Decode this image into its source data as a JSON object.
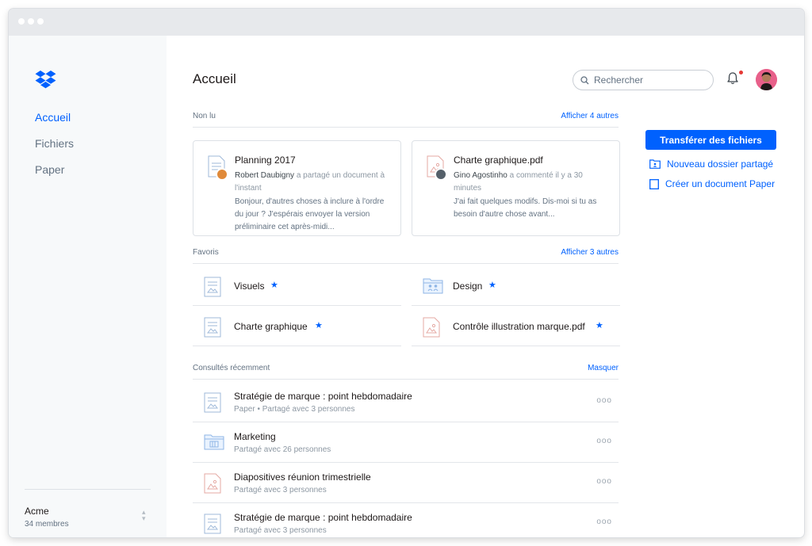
{
  "colors": {
    "accent": "#0061fe",
    "text": "#1e1919",
    "muted": "#637282",
    "notification": "#e53935"
  },
  "sidebar": {
    "logo_icon": "dropbox-logo-icon",
    "items": [
      {
        "label": "Accueil",
        "active": true
      },
      {
        "label": "Fichiers",
        "active": false
      },
      {
        "label": "Paper",
        "active": false
      }
    ],
    "team": {
      "name": "Acme",
      "members": "34 membres",
      "switch_icon": "chevron-updown-icon"
    }
  },
  "header": {
    "title": "Accueil",
    "search": {
      "placeholder": "Rechercher",
      "icon": "search-icon"
    },
    "bell_icon": "bell-icon",
    "has_notification": true,
    "avatar_icon": "user-avatar"
  },
  "unread": {
    "label": "Non lu",
    "action": "Afficher 4 autres",
    "cards": [
      {
        "title": "Planning 2017",
        "icon": "paper-doc-icon",
        "who": "Robert Daubigny",
        "action": " a partagé un document à l'instant",
        "excerpt": "Bonjour, d'autres choses à inclure à l'ordre du jour ? J'espérais envoyer la version préliminaire cet après-midi..."
      },
      {
        "title": "Charte graphique.pdf",
        "icon": "pdf-file-icon",
        "who": "Gino Agostinho",
        "action": " a commenté il y a 30 minutes",
        "excerpt": "J'ai fait quelques modifs. Dis-moi si tu as besoin d'autre chose avant..."
      }
    ]
  },
  "favorites": {
    "label": "Favoris",
    "action": "Afficher 3 autres",
    "items": [
      {
        "name": "Visuels",
        "icon": "paper-doc-icon",
        "starred": true
      },
      {
        "name": "Design",
        "icon": "shared-folder-icon",
        "starred": true
      },
      {
        "name": "Charte graphique",
        "icon": "paper-doc-icon",
        "starred": true
      },
      {
        "name": "Contrôle illustration marque.pdf",
        "icon": "pdf-file-icon",
        "starred": true
      }
    ]
  },
  "recent": {
    "label": "Consultés récemment",
    "action": "Masquer",
    "items": [
      {
        "name": "Stratégie de marque : point hebdomadaire",
        "sub": "Paper  •  Partagé avec 3 personnes",
        "icon": "paper-doc-icon"
      },
      {
        "name": "Marketing",
        "sub": "Partagé avec 26 personnes",
        "icon": "folder-icon"
      },
      {
        "name": "Diapositives réunion trimestrielle",
        "sub": "Partagé avec 3 personnes",
        "icon": "pdf-file-icon"
      },
      {
        "name": "Stratégie de marque : point hebdomadaire",
        "sub": "Partagé avec 3 personnes",
        "icon": "paper-doc-icon"
      }
    ],
    "more_label": "ooo"
  },
  "actions": {
    "upload_label": "Transférer des fichiers",
    "new_shared_folder": "Nouveau dossier partagé",
    "new_paper_doc": "Créer un document Paper"
  }
}
